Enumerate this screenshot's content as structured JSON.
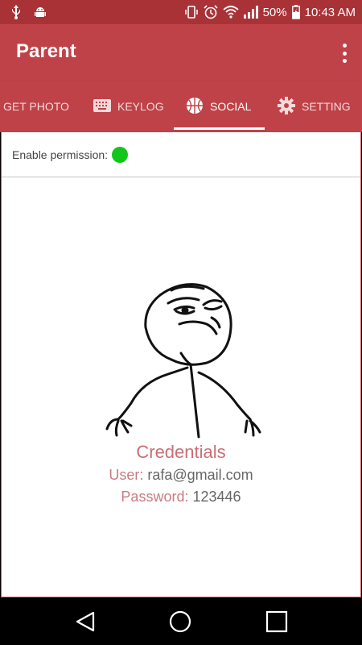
{
  "status_bar": {
    "battery": "50%",
    "time": "10:43 AM"
  },
  "app_bar": {
    "title": "Parent"
  },
  "tabs": [
    {
      "label": "GET PHOTO",
      "icon": "camera-icon",
      "active": false
    },
    {
      "label": "KEYLOG",
      "icon": "keyboard-icon",
      "active": false
    },
    {
      "label": "SOCIAL",
      "icon": "basketball-icon",
      "active": true
    },
    {
      "label": "SETTING",
      "icon": "gear-icon",
      "active": false
    }
  ],
  "permission": {
    "label": "Enable permission:",
    "status_color": "#12c51a"
  },
  "credentials": {
    "title": "Credentials",
    "user_label": "User:",
    "user_value": "rafa@gmail.com",
    "password_label": "Password:",
    "password_value": "123446"
  },
  "colors": {
    "status_bar": "#a93237",
    "app_bar": "#bf4248",
    "accent_text": "#c96f74"
  }
}
